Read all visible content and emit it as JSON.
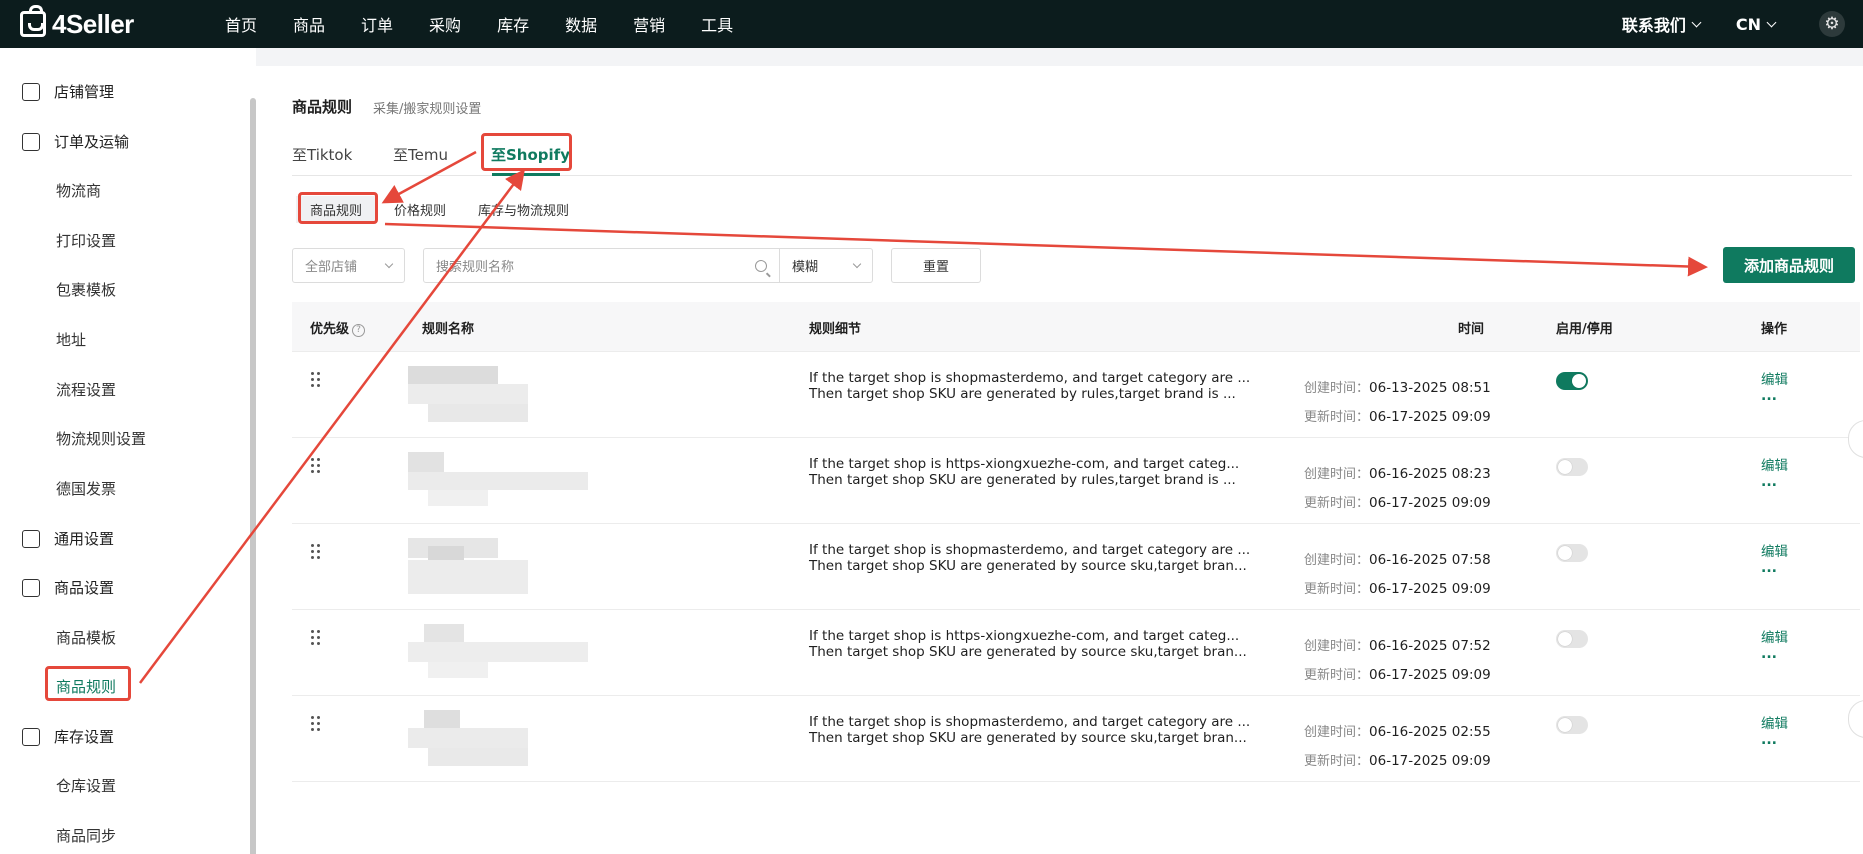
{
  "brand": {
    "name": "4Seller"
  },
  "nav": {
    "items": [
      "首页",
      "商品",
      "订单",
      "采购",
      "库存",
      "数据",
      "营销",
      "工具"
    ]
  },
  "topright": {
    "contact": "联系我们",
    "lang": "CN"
  },
  "sidebar": {
    "groups": [
      {
        "label": "店铺管理",
        "icon": "store-icon"
      },
      {
        "label": "订单及运输",
        "icon": "order-shipping-icon",
        "items": [
          "物流商",
          "打印设置",
          "包裹模板",
          "地址",
          "流程设置",
          "物流规则设置",
          "德国发票"
        ]
      },
      {
        "label": "通用设置",
        "icon": "general-settings-icon"
      },
      {
        "label": "商品设置",
        "icon": "product-settings-icon",
        "items": [
          "商品模板",
          "商品规则"
        ]
      },
      {
        "label": "库存设置",
        "icon": "inventory-settings-icon",
        "items": [
          "仓库设置",
          "商品同步"
        ]
      }
    ],
    "active_item": "商品规则"
  },
  "page": {
    "title": "商品规则",
    "subtitle": "采集/搬家规则设置"
  },
  "tabs": [
    {
      "label": "至Tiktok",
      "active": false
    },
    {
      "label": "至Temu",
      "active": false
    },
    {
      "label": "至Shopify",
      "active": true
    }
  ],
  "subtabs": [
    {
      "label": "商品规则",
      "active": true
    },
    {
      "label": "价格规则",
      "active": false
    },
    {
      "label": "库存与物流规则",
      "active": false
    }
  ],
  "filters": {
    "store_select": "全部店铺",
    "search_placeholder": "搜索规则名称",
    "mode_select": "模糊",
    "reset_label": "重置",
    "add_label": "添加商品规则"
  },
  "table": {
    "headers": {
      "priority": "优先级",
      "name": "规则名称",
      "detail": "规则细节",
      "time": "时间",
      "toggle": "启用/停用",
      "actions": "操作"
    },
    "created_label": "创建时间：",
    "updated_label": "更新时间：",
    "edit_label": "编辑",
    "more_label": "...",
    "rows": [
      {
        "detail_1": "If the target shop is shopmasterdemo, and target category are ...",
        "detail_2": "Then target shop SKU are generated by rules,target brand is ...",
        "created": "06-13-2025 08:51",
        "updated": "06-17-2025 09:09",
        "enabled": true
      },
      {
        "detail_1": "If the target shop is https-xiongxuezhe-com, and target categ...",
        "detail_2": "Then target shop SKU are generated by rules,target brand is ...",
        "created": "06-16-2025 08:23",
        "updated": "06-17-2025 09:09",
        "enabled": false
      },
      {
        "detail_1": "If the target shop is shopmasterdemo, and target category are ...",
        "detail_2": "Then target shop SKU are generated by source sku,target bran...",
        "created": "06-16-2025 07:58",
        "updated": "06-17-2025 09:09",
        "enabled": false
      },
      {
        "detail_1": "If the target shop is https-xiongxuezhe-com, and target categ...",
        "detail_2": "Then target shop SKU are generated by source sku,target bran...",
        "created": "06-16-2025 07:52",
        "updated": "06-17-2025 09:09",
        "enabled": false
      },
      {
        "detail_1": "If the target shop is shopmasterdemo, and target category are ...",
        "detail_2": "Then target shop SKU are generated by source sku,target bran...",
        "created": "06-16-2025 02:55",
        "updated": "06-17-2025 09:09",
        "enabled": false
      }
    ]
  },
  "colors": {
    "accent": "#0f7a5f",
    "annotation": "#e5483b",
    "topbar": "#0c1c1d"
  }
}
